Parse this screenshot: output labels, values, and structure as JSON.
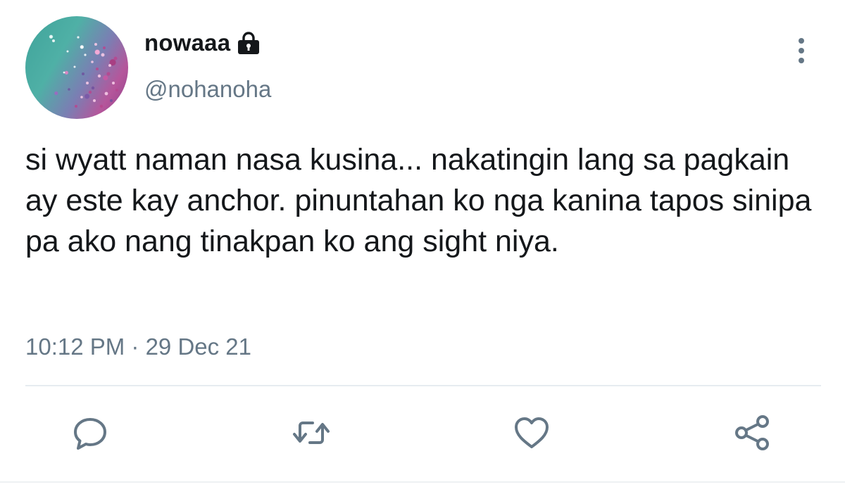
{
  "tweet": {
    "display_name": "nowaaa",
    "handle": "@nohanoha",
    "protected_icon": "lock-icon",
    "text": "si wyatt naman nasa kusina... nakatingin lang sa pagkain ay este kay anchor. pinuntahan ko nga kanina tapos sinipa pa ako nang tinakpan ko ang sight niya.",
    "timestamp": "10:12 PM · 29 Dec 21"
  },
  "actions": [
    {
      "name": "reply",
      "icon": "comment-icon"
    },
    {
      "name": "retweet",
      "icon": "retweet-icon"
    },
    {
      "name": "like",
      "icon": "heart-icon"
    },
    {
      "name": "share",
      "icon": "share-icon"
    }
  ],
  "menu_icon": "more-vertical-icon",
  "colors": {
    "text": "#14171a",
    "secondary": "#657786",
    "icon": "#657786",
    "divider": "#e6ecf0",
    "background": "#ffffff"
  }
}
